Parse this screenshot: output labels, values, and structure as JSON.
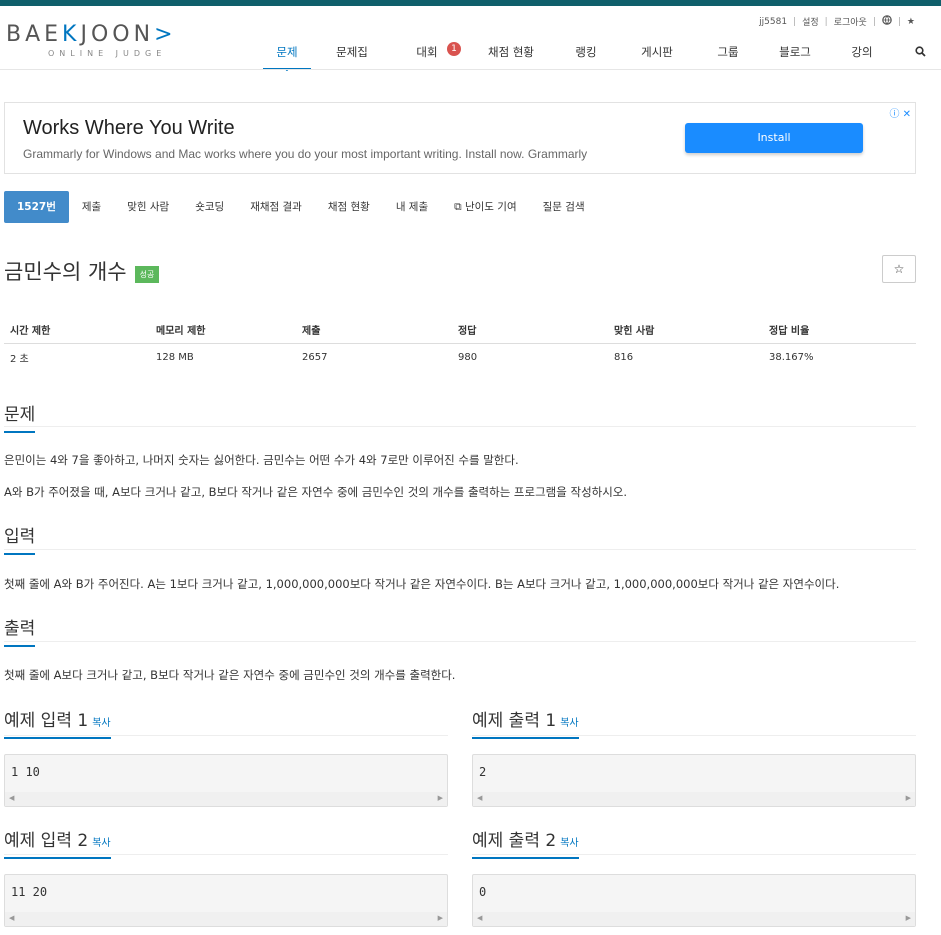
{
  "logo": {
    "main_left": "BAE",
    "main_acc1": "K",
    "main_mid": "JOON",
    "main_acc2": ">",
    "sub": "ONLINE JUDGE"
  },
  "userbar": {
    "user": "jj5581",
    "settings": "설정",
    "logout": "로그아웃",
    "globe_icon": "globe-icon",
    "star_icon": "star-icon"
  },
  "nav": {
    "items": [
      {
        "label": "문제 ⌄"
      },
      {
        "label": "문제집"
      },
      {
        "label": "대회",
        "badge": "1"
      },
      {
        "label": "채점 현황"
      },
      {
        "label": "랭킹"
      },
      {
        "label": "게시판"
      },
      {
        "label": "그룹"
      },
      {
        "label": "블로그"
      },
      {
        "label": "강의"
      }
    ],
    "search_icon": "search-icon"
  },
  "ad": {
    "title": "Works Where You Write",
    "text": "Grammarly for Windows and Mac works where you do your most important writing. Install now. Grammarly",
    "button": "Install",
    "icons": "ⓘ ✕"
  },
  "problem_tabs": [
    "1527번",
    "제출",
    "맞힌 사람",
    "숏코딩",
    "재채점 결과",
    "채점 현황",
    "내 제출",
    "난이도 기여",
    "질문 검색"
  ],
  "problem": {
    "title": "금민수의 개수",
    "badge": "성공",
    "star": "☆",
    "stats": {
      "headers": [
        "시간 제한",
        "메모리 제한",
        "제출",
        "정답",
        "맞힌 사람",
        "정답 비율"
      ],
      "values": [
        "2 초",
        "128 MB",
        "2657",
        "980",
        "816",
        "38.167%"
      ]
    }
  },
  "sections": {
    "problem": {
      "heading": "문제",
      "paragraphs": [
        "은민이는 4와 7을 좋아하고, 나머지 숫자는 싫어한다. 금민수는 어떤 수가 4와 7로만 이루어진 수를 말한다.",
        "A와 B가 주어졌을 때, A보다 크거나 같고, B보다 작거나 같은 자연수 중에 금민수인 것의 개수를 출력하는 프로그램을 작성하시오."
      ]
    },
    "input": {
      "heading": "입력",
      "text": "첫째 줄에 A와 B가 주어진다. A는 1보다 크거나 같고, 1,000,000,000보다 작거나 같은 자연수이다. B는 A보다 크거나 같고, 1,000,000,000보다 작거나 같은 자연수이다."
    },
    "output": {
      "heading": "출력",
      "text": "첫째 줄에 A보다 크거나 같고, B보다 작거나 같은 자연수 중에 금민수인 것의 개수를 출력한다."
    }
  },
  "examples": {
    "copy_label": "복사",
    "items": [
      {
        "in_title": "예제 입력 1",
        "in_value": "1 10",
        "out_title": "예제 출력 1",
        "out_value": "2"
      },
      {
        "in_title": "예제 입력 2",
        "in_value": "11 20",
        "out_title": "예제 출력 2",
        "out_value": "0"
      }
    ]
  }
}
